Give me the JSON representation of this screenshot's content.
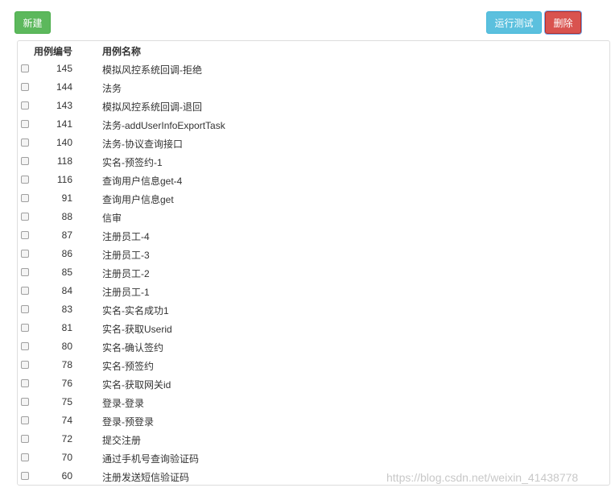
{
  "toolbar": {
    "new_label": "新建",
    "run_label": "运行测试",
    "delete_label": "删除"
  },
  "table": {
    "columns": [
      "用例编号",
      "用例名称"
    ],
    "rows": [
      {
        "id": "145",
        "name": "模拟风控系统回调-拒绝"
      },
      {
        "id": "144",
        "name": "法务"
      },
      {
        "id": "143",
        "name": "模拟风控系统回调-退回"
      },
      {
        "id": "141",
        "name": "法务-addUserInfoExportTask"
      },
      {
        "id": "140",
        "name": "法务-协议查询接口"
      },
      {
        "id": "118",
        "name": "实名-预签约-1"
      },
      {
        "id": "116",
        "name": "查询用户信息get-4"
      },
      {
        "id": "91",
        "name": "查询用户信息get"
      },
      {
        "id": "88",
        "name": "信审"
      },
      {
        "id": "87",
        "name": "注册员工-4"
      },
      {
        "id": "86",
        "name": "注册员工-3"
      },
      {
        "id": "85",
        "name": "注册员工-2"
      },
      {
        "id": "84",
        "name": "注册员工-1"
      },
      {
        "id": "83",
        "name": "实名-实名成功1"
      },
      {
        "id": "81",
        "name": "实名-获取Userid"
      },
      {
        "id": "80",
        "name": "实名-确认签约"
      },
      {
        "id": "78",
        "name": "实名-预签约"
      },
      {
        "id": "76",
        "name": "实名-获取网关id"
      },
      {
        "id": "75",
        "name": "登录-登录"
      },
      {
        "id": "74",
        "name": "登录-预登录"
      },
      {
        "id": "72",
        "name": "提交注册"
      },
      {
        "id": "70",
        "name": "通过手机号查询验证码"
      },
      {
        "id": "60",
        "name": "注册发送短信验证码"
      }
    ]
  },
  "watermark": "https://blog.csdn.net/weixin_41438778",
  "colors": {
    "new_button": "#5cb85c",
    "run_button": "#5bc0de",
    "delete_button": "#d9534f"
  }
}
